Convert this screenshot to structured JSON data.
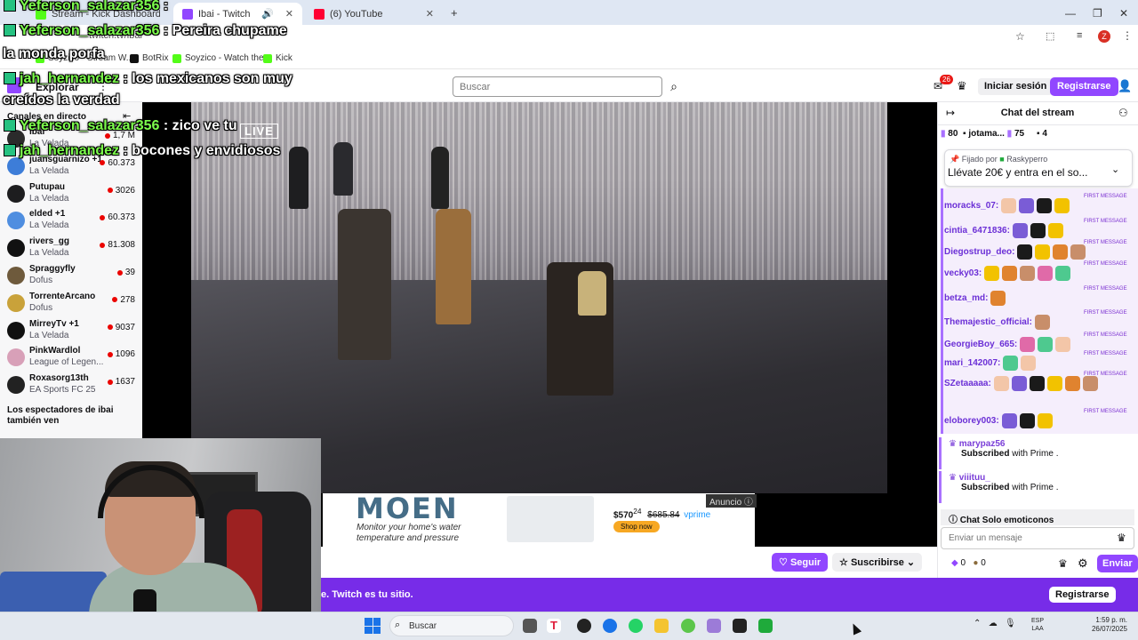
{
  "browser": {
    "tabs": [
      {
        "label": "Stream - Kick Dashboard",
        "favicon_color": "#53fc18"
      },
      {
        "label": "Ibai - Twitch",
        "favicon_color": "#9147ff"
      },
      {
        "label": "(6) YouTube",
        "favicon_color": "#ff0033"
      }
    ],
    "url": "twitch.tv/ibai",
    "bookmarks": [
      {
        "label": "Soyzico - Stream W...",
        "color": "#53fc18"
      },
      {
        "label": "BotRix",
        "color": "#111111"
      },
      {
        "label": "Soyzico - Watch the...",
        "color": "#53fc18"
      },
      {
        "label": "Kick",
        "color": "#53fc18"
      }
    ],
    "profile_initial": "Z"
  },
  "twitch_nav": {
    "explore_label": "Explorar",
    "search_placeholder": "Buscar",
    "notifications_count": "26",
    "login_label": "Iniciar sesión",
    "register_label": "Registrarse"
  },
  "sidebar": {
    "title": "Canales en directo",
    "channels": [
      {
        "name": "Ibai",
        "game": "La Velada",
        "viewers": "1,7 M",
        "avatar_color": "#2b2b2b"
      },
      {
        "name": "juansguarnizo +1",
        "game": "La Velada",
        "viewers": "60.373",
        "avatar_color": "#3d7dd8"
      },
      {
        "name": "Putupau",
        "game": "La Velada",
        "viewers": "3026",
        "avatar_color": "#1d1d1f"
      },
      {
        "name": "elded +1",
        "game": "La Velada",
        "viewers": "60.373",
        "avatar_color": "#4f8ee0"
      },
      {
        "name": "rivers_gg",
        "game": "La Velada",
        "viewers": "81.308",
        "avatar_color": "#111111"
      },
      {
        "name": "Spraggyfly",
        "game": "Dofus",
        "viewers": "39",
        "avatar_color": "#6e5a3c"
      },
      {
        "name": "TorrenteArcano",
        "game": "Dofus",
        "viewers": "278",
        "avatar_color": "#c9a23a"
      },
      {
        "name": "MirreyTv +1",
        "game": "La Velada",
        "viewers": "9037",
        "avatar_color": "#101010"
      },
      {
        "name": "PinkWardlol",
        "game": "League of Legen...",
        "viewers": "1096",
        "avatar_color": "#d8a0b8"
      },
      {
        "name": "Roxasorg13th",
        "game": "EA Sports FC 25",
        "viewers": "1637",
        "avatar_color": "#222222"
      }
    ],
    "also_watch": "Los espectadores de ibai también ven"
  },
  "video": {
    "watermark": "LIVE"
  },
  "ad": {
    "label": "Anuncio",
    "brand": "MOEN",
    "tagline": "Monitor your home's water temperature and pressure",
    "price": "$570",
    "price_cents": "24",
    "old_price": "$685.84",
    "prime": "vprime",
    "shop_label": "Shop now"
  },
  "actions": {
    "follow_label": "Seguir",
    "subscribe_label": "Suscribirse"
  },
  "chat": {
    "title": "Chat del stream",
    "leaderboard": [
      {
        "rank_value": "80"
      },
      {
        "name": "jotama...",
        "value": "75"
      },
      {
        "value": "4"
      }
    ],
    "pinned_by": "Fijado por",
    "pinned_user": "Raskyperro",
    "pinned_message": "Llévate 20€ y entra en el so...",
    "first_message_label": "FIRST MESSAGE",
    "messages": [
      {
        "user": "moracks_07:",
        "color": "#6b2fd6",
        "emotes": 4
      },
      {
        "user": "cintia_6471836:",
        "color": "#6b2fd6",
        "emotes": 3
      },
      {
        "user": "Diegostrup_deo:",
        "color": "#6b2fd6",
        "emotes": 4
      },
      {
        "user": "vecky03:",
        "color": "#6b2fd6",
        "emotes": 5
      },
      {
        "user": "betza_md:",
        "color": "#6b2fd6",
        "emotes": 1
      },
      {
        "user": "Themajestic_official:",
        "color": "#6b2fd6",
        "emotes": 1
      },
      {
        "user": "GeorgieBoy_665:",
        "color": "#6b2fd6",
        "emotes": 3
      },
      {
        "user": "mari_142007:",
        "color": "#6b2fd6",
        "emotes": 2
      },
      {
        "user": "SZetaaaaa:",
        "color": "#6b2fd6",
        "emotes": 6
      },
      {
        "user": "eloborey003:",
        "color": "#6b2fd6",
        "emotes": 3
      }
    ],
    "subs": [
      {
        "user": "marypaz56",
        "text": "Subscribed",
        "suffix": "with Prime ."
      },
      {
        "user": "viiituu_",
        "text": "Subscribed",
        "suffix": "with Prime ."
      }
    ],
    "emote_only": "Chat Solo emoticonos",
    "input_placeholder": "Enviar un mensaje",
    "bits": "0",
    "points": "0",
    "send_label": "Enviar"
  },
  "banner": {
    "text": "e. Twitch es tu sitio.",
    "button": "Registrarse"
  },
  "stream_overlay": {
    "lines": [
      {
        "user": "Yeferson_salazar356",
        "text": ":"
      },
      {
        "user": "Yeferson_salazar356",
        "text": ": Pereira chupame"
      },
      {
        "user": "",
        "text": "la monda porfa"
      },
      {
        "user": "jah_hernandez",
        "text": ": los mexicanos son muy"
      },
      {
        "user": "",
        "text": "creídos la verdad"
      },
      {
        "user": "Yeferson_salazar356",
        "text": ": zico ve tu"
      },
      {
        "user": "jah_hernandez",
        "text": ": bocones y envidiosos"
      }
    ]
  },
  "taskbar": {
    "search_placeholder": "Buscar",
    "lang_top": "ESP",
    "lang_bottom": "LAA",
    "time": "1:59 p. m.",
    "date": "26/07/2025"
  }
}
